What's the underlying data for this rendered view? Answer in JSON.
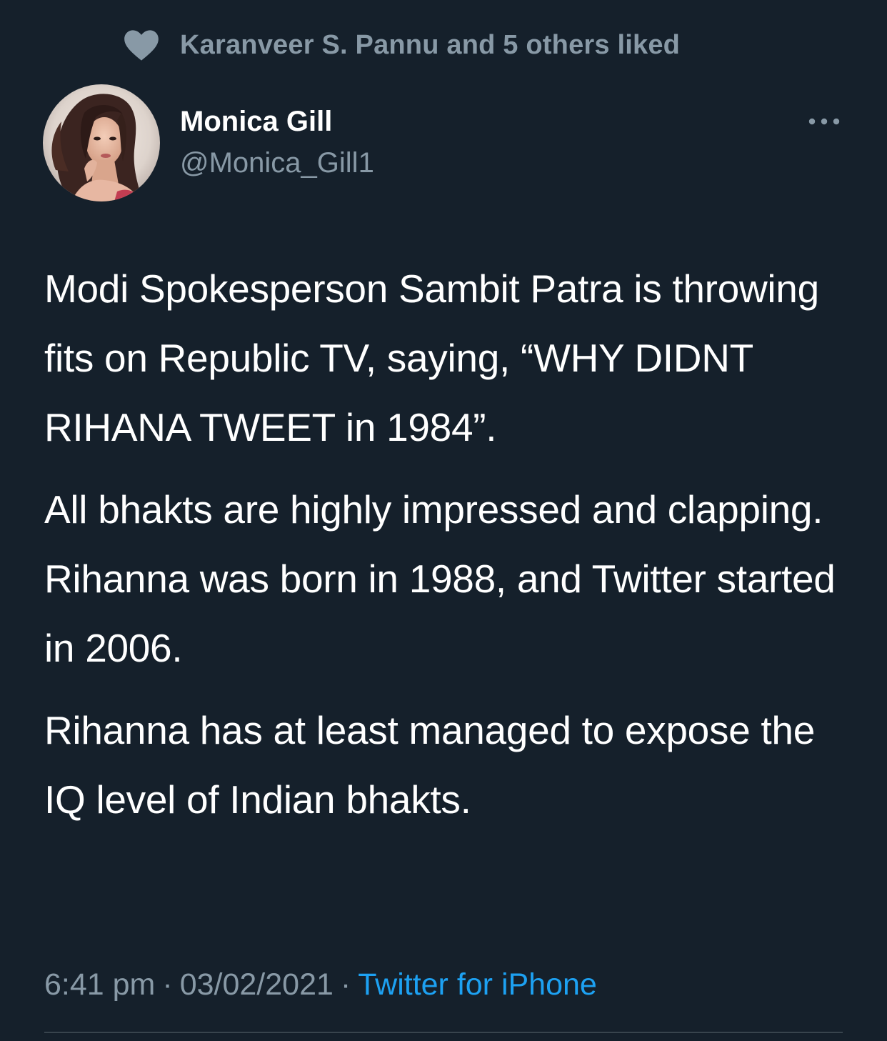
{
  "theme": {
    "background": "#15202b",
    "primary_text": "#ffffff",
    "secondary_text": "#8899a6",
    "link": "#1da1f2",
    "divider": "#38444d"
  },
  "social_context": {
    "icon": "heart-icon",
    "text": "Karanveer S. Pannu and 5 others liked"
  },
  "author": {
    "display_name": "Monica Gill",
    "handle": "@Monica_Gill1",
    "avatar": "profile-photo"
  },
  "tweet": {
    "paragraphs": [
      "Modi Spokesperson Sambit Patra is throwing fits on Republic TV, saying, “WHY DIDNT RIHANA TWEET in 1984”.",
      "All bhakts are highly impressed and clapping. Rihanna was born in 1988, and Twitter started in 2006.",
      "Rihanna has at least managed to expose the IQ level of Indian bhakts."
    ]
  },
  "meta": {
    "time": "6:41 pm",
    "separator": "·",
    "date": "03/02/2021",
    "source": "Twitter for iPhone"
  },
  "more_icon": "more-dots-icon"
}
